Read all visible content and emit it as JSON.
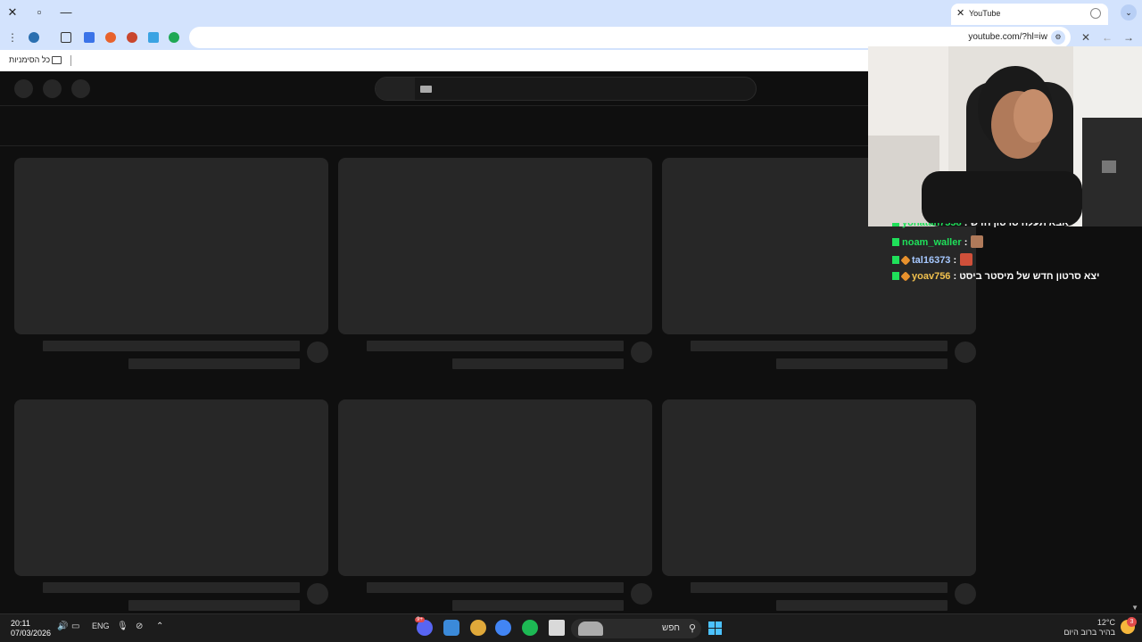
{
  "browser": {
    "tab_title": "YouTube",
    "tab_close_glyph": "✕",
    "new_tab_glyph": "+",
    "url": "youtube.com/?hl=iw",
    "bookmarks_label": "כל הסימניות",
    "window_controls": {
      "close": "✕",
      "restore": "▫",
      "minimize": "—"
    },
    "toolbar": {
      "menu": "⋮",
      "star": "☆",
      "back": "←",
      "forward": "→",
      "stop": "✕",
      "tune": "⚙",
      "tabs": "⌄"
    }
  },
  "youtube": {
    "state": "loading-skeleton",
    "grid_rows": 2,
    "grid_cols": 3
  },
  "stream_overlay": {
    "chat": [
      {
        "user": "yonatan7558",
        "text": "אבא תעלה סרטון חדש",
        "user_color": "#1fe05a",
        "partial": true
      },
      {
        "user": "noam_waller",
        "text": "",
        "user_color": "#1fe05a",
        "emote_color": "#b07a5a"
      },
      {
        "user": "tal16373",
        "text": "",
        "user_color": "#a6c8ff",
        "emote_color": "#d0503a"
      },
      {
        "user": "yoav756",
        "text": "יצא סרטון חדש של מיסטר ביסט",
        "user_color": "#f2c14e"
      }
    ],
    "separator": " :"
  },
  "taskbar": {
    "time": "20:11",
    "date": "07/03/2026",
    "language": "ENG",
    "search_label": "חפש",
    "weather_temp": "12°C",
    "weather_desc": "בהיר ברוב היום",
    "weather_badge": "3",
    "discord_badge": "9+",
    "tray": {
      "volume": "🔊",
      "screen": "▭",
      "mic": "🎙",
      "hidden": "⌃",
      "wifi_off": "⊘"
    }
  },
  "colors": {
    "chrome_frame": "#d3e3fd",
    "yt_bg": "#0f0f0f",
    "skeleton": "#272727",
    "taskbar": "#1c1c1c"
  }
}
